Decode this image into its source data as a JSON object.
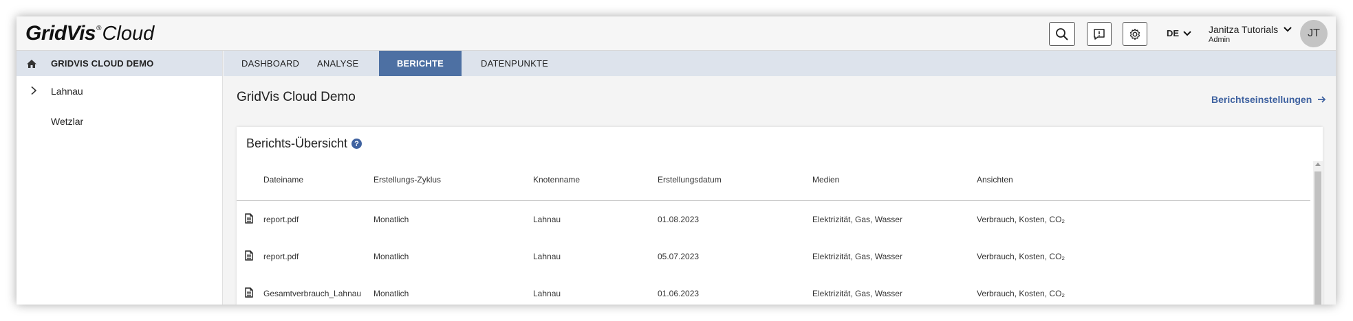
{
  "app": {
    "logo_bold": "GridVis",
    "logo_reg": "®",
    "logo_light": "Cloud"
  },
  "header": {
    "language": "DE",
    "user_name": "Janitza Tutorials",
    "user_role": "Admin",
    "avatar_initials": "JT",
    "icons": [
      "search-icon",
      "feedback-icon",
      "gear-icon",
      "chevron-down-icon"
    ]
  },
  "sidebar": {
    "root_label": "GRIDVIS CLOUD DEMO",
    "items": [
      {
        "label": "Lahnau",
        "expandable": true
      },
      {
        "label": "Wetzlar",
        "expandable": false
      }
    ]
  },
  "tabs": [
    {
      "label": "DASHBOARD",
      "active": false
    },
    {
      "label": "ANALYSE",
      "active": false
    },
    {
      "label": "BERICHTE",
      "active": true
    },
    {
      "label": "DATENPUNKTE",
      "active": false
    }
  ],
  "main": {
    "title": "GridVis Cloud Demo",
    "settings_link": "Berichtseinstellungen",
    "card_title": "Berichts-Übersicht",
    "help_glyph": "?"
  },
  "table": {
    "columns": [
      "Dateiname",
      "Erstellungs-Zyklus",
      "Knotenname",
      "Erstellungsdatum",
      "Medien",
      "Ansichten"
    ],
    "rows": [
      [
        "report.pdf",
        "Monatlich",
        "Lahnau",
        "01.08.2023",
        "Elektrizität, Gas, Wasser",
        "Verbrauch, Kosten, CO₂"
      ],
      [
        "report.pdf",
        "Monatlich",
        "Lahnau",
        "05.07.2023",
        "Elektrizität, Gas, Wasser",
        "Verbrauch, Kosten, CO₂"
      ],
      [
        "Gesamtverbrauch_Lahnau",
        "Monatlich",
        "Lahnau",
        "01.06.2023",
        "Elektrizität, Gas, Wasser",
        "Verbrauch, Kosten, CO₂"
      ]
    ]
  },
  "colors": {
    "accent": "#4d70a3",
    "link": "#3f62a0",
    "nav_bg": "#dde3ec"
  }
}
